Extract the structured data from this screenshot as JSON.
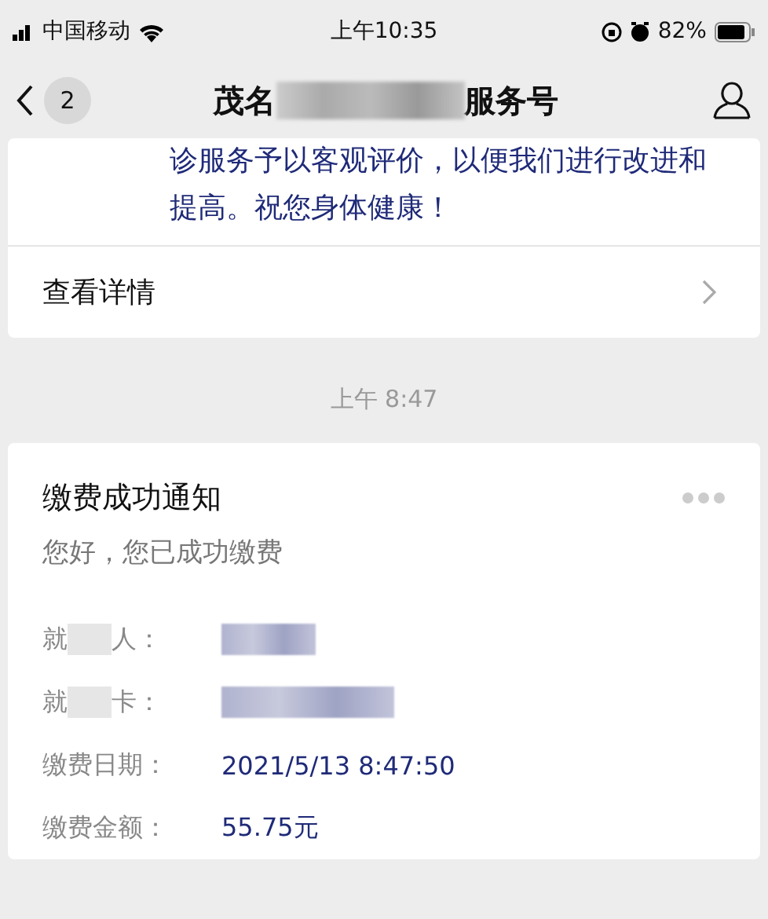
{
  "status_bar": {
    "carrier": "中国移动",
    "time": "上午10:35",
    "battery": "82%"
  },
  "nav": {
    "unread": "2",
    "title_start": "茂名",
    "title_end": "服务号"
  },
  "message_card": {
    "text": "诊服务予以客观评价，以便我们进行改进和提高。祝您身体健康！",
    "link": "查看详情"
  },
  "timestamp": "上午 8:47",
  "notice": {
    "title": "缴费成功通知",
    "greeting": "您好，您已成功缴费",
    "fields": [
      {
        "kind": "redacted",
        "label_start": "就",
        "label_end": "人："
      },
      {
        "kind": "redacted",
        "label_start": "就",
        "label_end": "卡："
      },
      {
        "kind": "text",
        "label": "缴费日期：",
        "value": "2021/5/13 8:47:50"
      },
      {
        "kind": "text",
        "label": "缴费金额：",
        "value": "55.75元"
      }
    ]
  }
}
